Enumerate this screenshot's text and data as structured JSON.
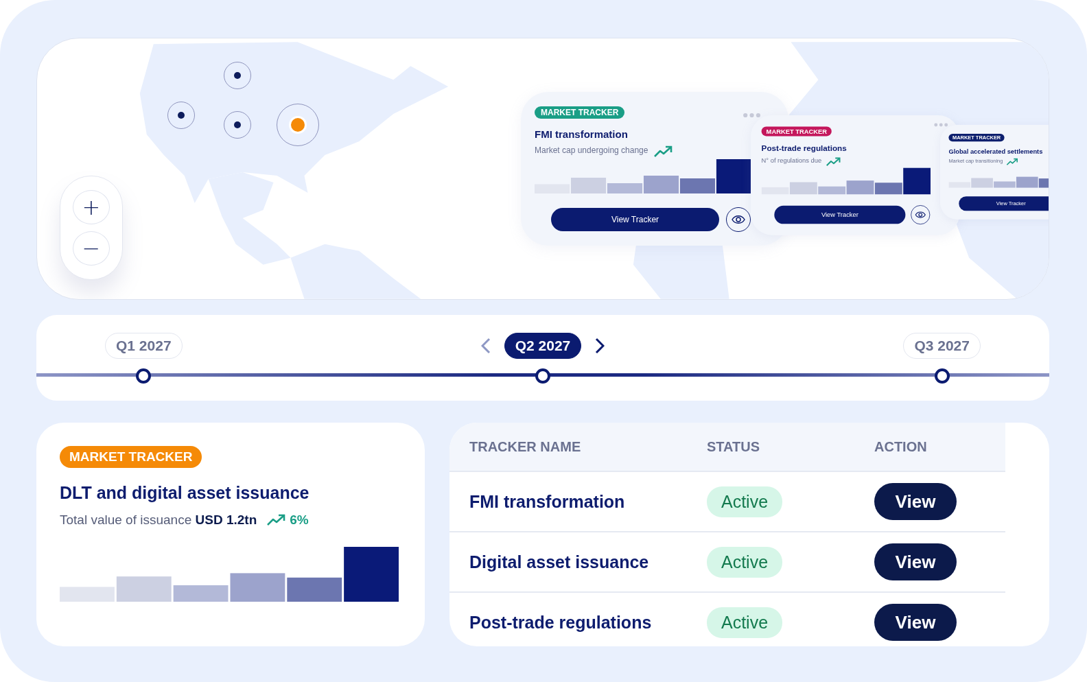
{
  "map": {
    "pins": [
      {
        "selected": false
      },
      {
        "selected": false
      },
      {
        "selected": false
      },
      {
        "selected": true
      }
    ],
    "zoom_controls": [
      "+",
      "−"
    ],
    "trackers": [
      {
        "badge": "MARKET TRACKER",
        "color": "#1a9e86",
        "title": "FMI transformation",
        "subtitle": "Market cap undergoing change",
        "button": "View Tracker",
        "window_dots": false,
        "preview": true
      },
      {
        "badge": "MARKET TRACKER",
        "color": "#c4175c",
        "title": "Post-trade regulations",
        "subtitle": "N° of regulations due",
        "button": "View Tracker",
        "window_dots": true,
        "preview": true
      },
      {
        "badge": "MARKET TRACKER",
        "color": "#0d1f6e",
        "title": "Global accelerated settlements",
        "subtitle": "Market cap transitioning",
        "button": "View Tracker",
        "window_dots": true,
        "preview": false
      }
    ]
  },
  "timeline": {
    "quarters": [
      {
        "label": "Q1 2027",
        "selected": false
      },
      {
        "label": "Q2 2027",
        "selected": true
      },
      {
        "label": "Q3 2027",
        "selected": false
      }
    ]
  },
  "featured": {
    "badge": "MARKET TRACKER",
    "color": "#f58a07",
    "title": "DLT and digital asset issuance",
    "subtitle": "Total value of issuance **USD 1.2tn**",
    "change": "6%"
  },
  "table": {
    "columns": [
      "TRACKER NAME",
      "STATUS",
      "ACTION"
    ],
    "rows": [
      {
        "name": "FMI transformation",
        "status": "Active",
        "action": "View"
      },
      {
        "name": "Digital asset issuance",
        "status": "Active",
        "action": "View"
      },
      {
        "name": "Post-trade regulations",
        "status": "Active",
        "action": "View"
      }
    ]
  }
}
